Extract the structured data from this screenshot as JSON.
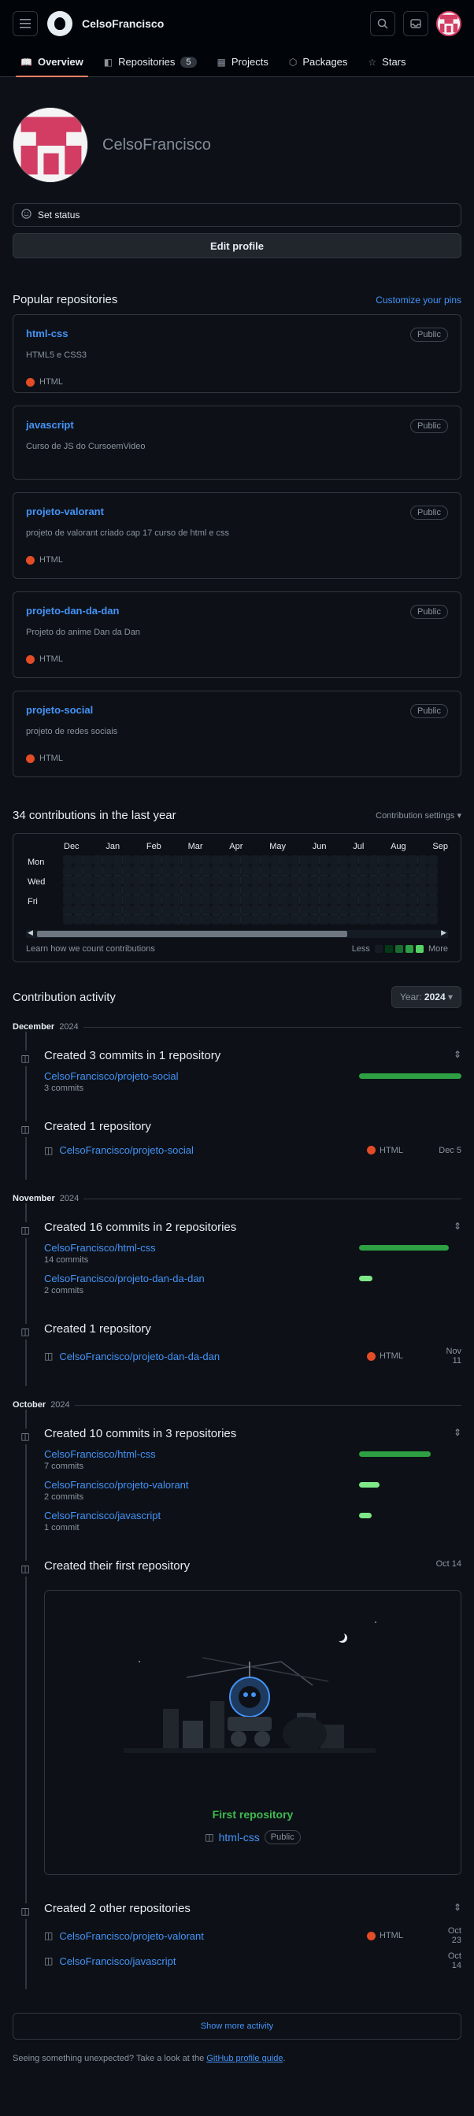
{
  "header": {
    "menu_icon": "hamburger-icon",
    "username": "CelsoFrancisco",
    "search_icon": "search-icon",
    "inbox_icon": "inbox-icon"
  },
  "tabs": [
    {
      "label": "Overview",
      "icon": "book-icon",
      "counter": ""
    },
    {
      "label": "Repositories",
      "icon": "repo-icon",
      "counter": "5"
    },
    {
      "label": "Projects",
      "icon": "table-icon",
      "counter": ""
    },
    {
      "label": "Packages",
      "icon": "package-icon",
      "counter": ""
    },
    {
      "label": "Stars",
      "icon": "star-icon",
      "counter": ""
    }
  ],
  "profile": {
    "display_name": "CelsoFrancisco",
    "set_status_label": "Set status",
    "edit_profile_label": "Edit profile"
  },
  "popular": {
    "title": "Popular repositories",
    "customize_label": "Customize your pins",
    "repos": [
      {
        "name": "html-css",
        "desc": "HTML5 e CSS3",
        "lang": "HTML",
        "visibility": "Public"
      },
      {
        "name": "javascript",
        "desc": "Curso de JS do CursoemVideo",
        "lang": "",
        "visibility": "Public"
      },
      {
        "name": "projeto-valorant",
        "desc": "projeto de valorant criado cap 17 curso de html e css",
        "lang": "HTML",
        "visibility": "Public"
      },
      {
        "name": "projeto-dan-da-dan",
        "desc": "Projeto do anime Dan da Dan",
        "lang": "HTML",
        "visibility": "Public"
      },
      {
        "name": "projeto-social",
        "desc": "projeto de redes sociais",
        "lang": "HTML",
        "visibility": "Public"
      }
    ]
  },
  "contributions": {
    "title": "34 contributions in the last year",
    "settings_label": "Contribution settings",
    "months": [
      "Dec",
      "Jan",
      "Feb",
      "Mar",
      "Apr",
      "May",
      "Jun",
      "Jul",
      "Aug",
      "Sep"
    ],
    "days": [
      "Mon",
      "Wed",
      "Fri"
    ],
    "learn_label": "Learn how we count contributions",
    "less_label": "Less",
    "more_label": "More",
    "legend_colors": [
      "#151b23",
      "#033a16",
      "#196c2e",
      "#2ea043",
      "#56d364"
    ]
  },
  "activity": {
    "title": "Contribution activity",
    "year_label": "Year:",
    "year_value": "2024",
    "show_more_label": "Show more activity",
    "footer_text": "Seeing something unexpected? Take a look at the",
    "footer_link": "GitHub profile guide",
    "footer_end": ".",
    "dec": {
      "month": "December",
      "year": "2024",
      "commits_title": "Created 3 commits in 1 repository",
      "commit_rows": [
        {
          "repo": "CelsoFrancisco/projeto-social",
          "count": "3 commits",
          "fraction": 1.0
        }
      ],
      "repo_title": "Created 1 repository",
      "repo": {
        "name": "CelsoFrancisco/projeto-social",
        "lang": "HTML",
        "date": "Dec 5"
      }
    },
    "nov": {
      "month": "November",
      "year": "2024",
      "commits_title": "Created 16 commits in 2 repositories",
      "commit_rows": [
        {
          "repo": "CelsoFrancisco/html-css",
          "count": "14 commits",
          "fraction": 0.88
        },
        {
          "repo": "CelsoFrancisco/projeto-dan-da-dan",
          "count": "2 commits",
          "fraction": 0.13
        }
      ],
      "repo_title": "Created 1 repository",
      "repo": {
        "name": "CelsoFrancisco/projeto-dan-da-dan",
        "lang": "HTML",
        "date": "Nov 11"
      }
    },
    "oct": {
      "month": "October",
      "year": "2024",
      "commits_title": "Created 10 commits in 3 repositories",
      "commit_rows": [
        {
          "repo": "CelsoFrancisco/html-css",
          "count": "7 commits",
          "fraction": 0.7
        },
        {
          "repo": "CelsoFrancisco/projeto-valorant",
          "count": "2 commits",
          "fraction": 0.2
        },
        {
          "repo": "CelsoFrancisco/javascript",
          "count": "1 commit",
          "fraction": 0.1
        }
      ],
      "first_title": "Created their first repository",
      "first_date": "Oct 14",
      "first_card_title": "First repository",
      "first_repo": "html-css",
      "first_visibility": "Public",
      "other_title": "Created 2 other repositories",
      "other_repos": [
        {
          "name": "CelsoFrancisco/projeto-valorant",
          "lang": "HTML",
          "date": "Oct 23"
        },
        {
          "name": "CelsoFrancisco/javascript",
          "lang": "",
          "date": "Oct 14"
        }
      ]
    }
  }
}
